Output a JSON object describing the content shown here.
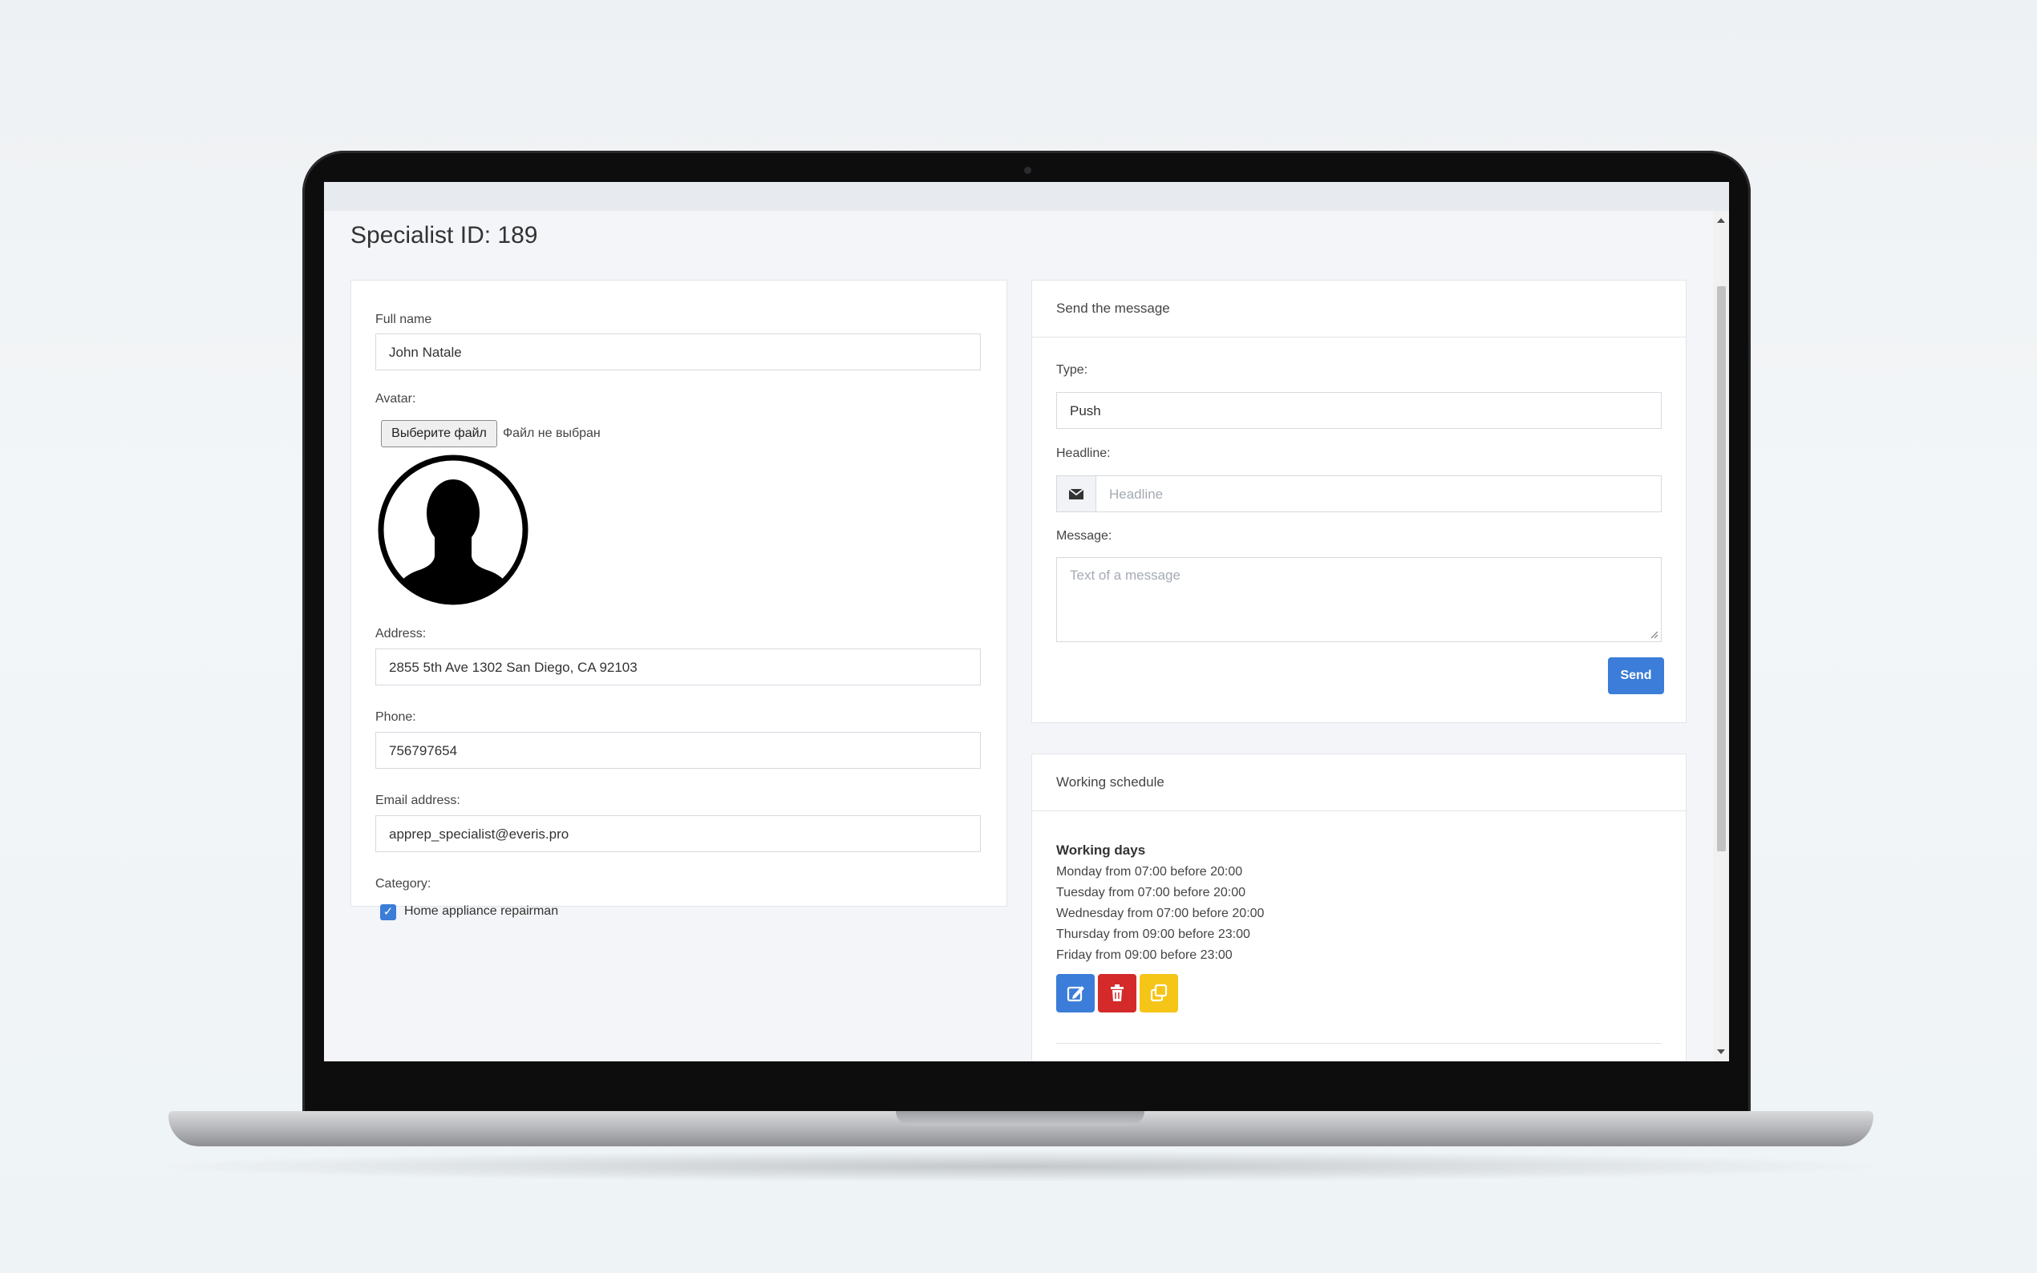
{
  "page": {
    "title": "Specialist ID: 189"
  },
  "profile": {
    "full_name_label": "Full name",
    "full_name_value": "John Natale",
    "avatar_label": "Avatar:",
    "file_button": "Выберите файл",
    "file_status": "Файл не выбран",
    "avatar_icon": "person-silhouette-icon",
    "address_label": "Address:",
    "address_value": "2855 5th Ave 1302 San Diego, CA 92103",
    "phone_label": "Phone:",
    "phone_value": "756797654",
    "email_label": "Email address:",
    "email_value": "apprep_specialist@everis.pro",
    "category_label": "Category:",
    "category_checked": true,
    "category_item": "Home appliance repairman"
  },
  "message": {
    "header": "Send the message",
    "type_label": "Type:",
    "type_value": "Push",
    "headline_label": "Headline:",
    "headline_placeholder": "Headline",
    "headline_icon": "envelope-icon",
    "message_label": "Message:",
    "message_placeholder": "Text of a message",
    "send_button": "Send"
  },
  "schedule": {
    "header": "Working schedule",
    "title": "Working days",
    "days": [
      "Monday from 07:00 before 20:00",
      "Tuesday from 07:00 before 20:00",
      "Wednesday from 07:00 before 20:00",
      "Thursday from 09:00 before 23:00",
      "Friday from 09:00 before 23:00"
    ],
    "buttons": [
      {
        "icon": "edit-icon",
        "color": "#3b7dd8"
      },
      {
        "icon": "trash-icon",
        "color": "#d42a2a"
      },
      {
        "icon": "copy-icon",
        "color": "#f5c518"
      }
    ]
  },
  "colors": {
    "primary": "#3b7dd8",
    "danger": "#d42a2a",
    "warning": "#f5c518"
  }
}
